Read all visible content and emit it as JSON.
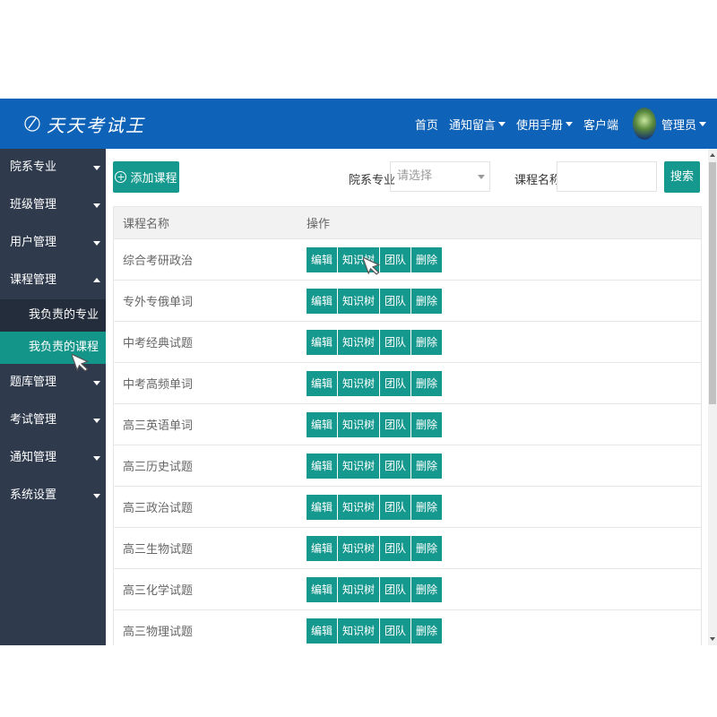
{
  "header": {
    "logo_text": "天天考试王",
    "nav": [
      {
        "label": "首页",
        "dropdown": false
      },
      {
        "label": "通知留言",
        "dropdown": true
      },
      {
        "label": "使用手册",
        "dropdown": true
      },
      {
        "label": "客户端",
        "dropdown": false
      }
    ],
    "user_label": "管理员"
  },
  "sidebar": {
    "items": [
      {
        "label": "院系专业",
        "expanded": false
      },
      {
        "label": "班级管理",
        "expanded": false
      },
      {
        "label": "用户管理",
        "expanded": false
      },
      {
        "label": "课程管理",
        "expanded": true
      },
      {
        "label": "题库管理",
        "expanded": false
      },
      {
        "label": "考试管理",
        "expanded": false
      },
      {
        "label": "通知管理",
        "expanded": false
      },
      {
        "label": "系统设置",
        "expanded": false
      }
    ],
    "sub_items": [
      {
        "label": "我负责的专业",
        "active": false
      },
      {
        "label": "我负责的课程",
        "active": true
      }
    ]
  },
  "toolbar": {
    "add_label": "添加课程",
    "dept_label": "院系专业",
    "dept_placeholder": "请选择",
    "course_label": "课程名称",
    "course_value": "",
    "search_label": "搜索"
  },
  "table": {
    "headers": [
      "课程名称",
      "操作"
    ],
    "actions": [
      "编辑",
      "知识树",
      "团队",
      "删除"
    ],
    "rows": [
      "综合考研政治",
      "专外专俄单词",
      "中考经典试题",
      "中考高频单词",
      "高三英语单词",
      "高三历史试题",
      "高三政治试题",
      "高三生物试题",
      "高三化学试题",
      "高三物理试题"
    ]
  },
  "colors": {
    "header_bg": "#0e62b7",
    "sidebar_bg": "#2f3a4c",
    "accent": "#15998e"
  }
}
